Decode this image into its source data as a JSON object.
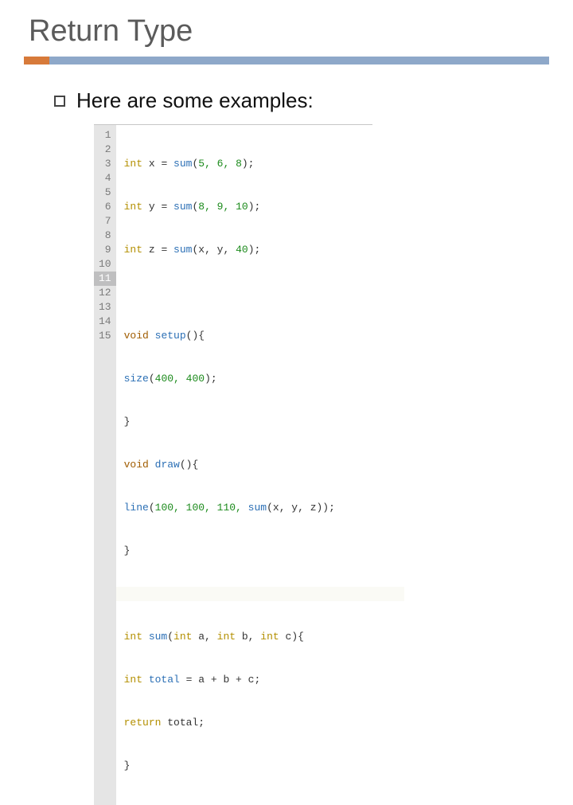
{
  "title": "Return Type",
  "bullet": "Here are some examples:",
  "code": {
    "gutter": [
      "1",
      "2",
      "3",
      "4",
      "5",
      "6",
      "7",
      "8",
      "9",
      "10",
      "11",
      "12",
      "13",
      "14",
      "15"
    ],
    "active_line": 11,
    "tokens": {
      "int": "int",
      "void": "void",
      "return": "return",
      "setup": "setup",
      "draw": "draw",
      "size": "size",
      "line": "line",
      "sum": "sum",
      "total": "total"
    },
    "lines": {
      "l1": {
        "var": "x",
        "args": "5, 6, 8"
      },
      "l2": {
        "var": "y",
        "args": "8, 9, 10"
      },
      "l3": {
        "var": "z",
        "args_open": "x, y, ",
        "lit": "40"
      },
      "l6": {
        "args": "400, 400"
      },
      "l9": {
        "args_open": "100, 100, 110, ",
        "inner_args": "x, y, z"
      },
      "l12": {
        "params1": "int",
        "p1": " a, ",
        "params2": "int",
        "p2": " b, ",
        "params3": "int",
        "p3": " c"
      },
      "l13": {
        "expr": " = a + b + c;"
      },
      "l14": {
        "expr": " total;"
      }
    }
  }
}
